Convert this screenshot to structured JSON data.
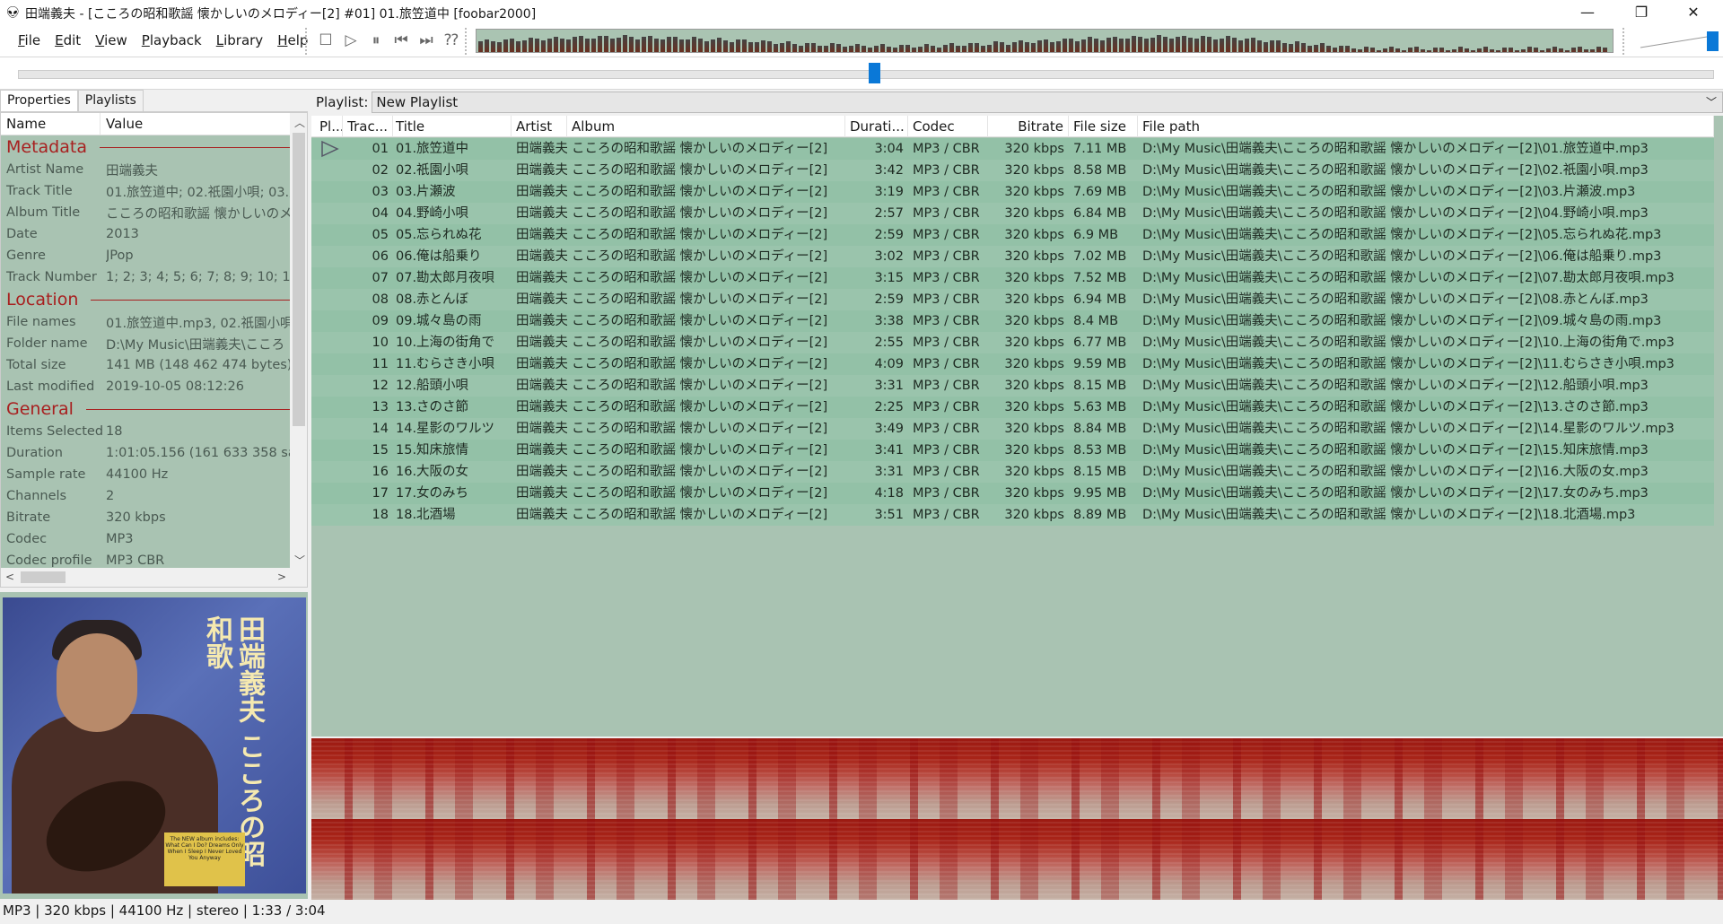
{
  "window": {
    "title": "田端義夫 - [こころの昭和歌謡 懐かしいのメロディー[2] #01] 01.旅笠道中  [foobar2000]",
    "minimize": "—",
    "restore": "❐",
    "close": "✕"
  },
  "menu": [
    "File",
    "Edit",
    "View",
    "Playback",
    "Library",
    "Help"
  ],
  "transport": [
    {
      "name": "stop",
      "glyph": "☐"
    },
    {
      "name": "play",
      "glyph": "▷"
    },
    {
      "name": "pause",
      "glyph": "⏸"
    },
    {
      "name": "previous",
      "glyph": "⏮"
    },
    {
      "name": "next",
      "glyph": "⏭"
    },
    {
      "name": "random",
      "glyph": "⁇"
    }
  ],
  "colors": {
    "accent": "#0a78d7",
    "row": "#93c1a7",
    "panel_bg": "#a9c3b2",
    "section": "#a82020",
    "spectrogram": "#9c1a12"
  },
  "seek": {
    "position": "1:33",
    "length": "3:04",
    "fraction": 0.505
  },
  "volume": {
    "fraction": 0.95
  },
  "left_tabs": [
    "Properties",
    "Playlists"
  ],
  "properties": {
    "headers": {
      "name": "Name",
      "value": "Value"
    },
    "sections": [
      {
        "title": "Metadata",
        "rows": [
          [
            "Artist Name",
            "田端義夫"
          ],
          [
            "Track Title",
            "01.旅笠道中; 02.祇園小唄; 03.片"
          ],
          [
            "Album Title",
            "こころの昭和歌謡 懐かしいのメ"
          ],
          [
            "Date",
            "2013"
          ],
          [
            "Genre",
            "JPop"
          ],
          [
            "Track Number",
            "1; 2; 3; 4; 5; 6; 7; 8; 9; 10; 11; 1"
          ]
        ]
      },
      {
        "title": "Location",
        "rows": [
          [
            "File names",
            "01.旅笠道中.mp3, 02.祇園小唄"
          ],
          [
            "Folder name",
            "D:\\My Music\\田端義夫\\こころ"
          ],
          [
            "Total size",
            "141 MB (148 462 474 bytes)"
          ],
          [
            "Last modified",
            "2019-10-05 08:12:26"
          ]
        ]
      },
      {
        "title": "General",
        "rows": [
          [
            "Items Selected",
            "18"
          ],
          [
            "Duration",
            "1:01:05.156 (161 633 358 sam"
          ],
          [
            "Sample rate",
            "44100 Hz"
          ],
          [
            "Channels",
            "2"
          ],
          [
            "Bitrate",
            "320 kbps"
          ],
          [
            "Codec",
            "MP3"
          ],
          [
            "Codec profile",
            "MP3 CBR"
          ]
        ]
      }
    ]
  },
  "album_art": {
    "text": "田端義夫 こころの昭和歌",
    "sticker": "The NEW album includes: What Can I Do? Dreams Only When I Sleep I Never Loved You Anyway"
  },
  "playlist_bar": {
    "label": "Playlist:",
    "selected": "New Playlist"
  },
  "columns": [
    "Pl...",
    "Trac...",
    "Title",
    "Artist",
    "Album",
    "Durati...",
    "Codec",
    "Bitrate",
    "File size",
    "File path"
  ],
  "tracks": [
    [
      "01",
      "01.旅笠道中",
      "3:04",
      "7.11 MB"
    ],
    [
      "02",
      "02.祇園小唄",
      "3:42",
      "8.58 MB"
    ],
    [
      "03",
      "03.片瀬波",
      "3:19",
      "7.69 MB"
    ],
    [
      "04",
      "04.野崎小唄",
      "2:57",
      "6.84 MB"
    ],
    [
      "05",
      "05.忘られぬ花",
      "2:59",
      "6.9 MB"
    ],
    [
      "06",
      "06.俺は船乗り",
      "3:02",
      "7.02 MB"
    ],
    [
      "07",
      "07.勘太郎月夜唄",
      "3:15",
      "7.52 MB"
    ],
    [
      "08",
      "08.赤とんぼ",
      "2:59",
      "6.94 MB"
    ],
    [
      "09",
      "09.城々島の雨",
      "3:38",
      "8.4 MB"
    ],
    [
      "10",
      "10.上海の街角で",
      "2:55",
      "6.77 MB"
    ],
    [
      "11",
      "11.むらさき小唄",
      "4:09",
      "9.59 MB"
    ],
    [
      "12",
      "12.船頭小唄",
      "3:31",
      "8.15 MB"
    ],
    [
      "13",
      "13.さのさ節",
      "2:25",
      "5.63 MB"
    ],
    [
      "14",
      "14.星影のワルツ",
      "3:49",
      "8.84 MB"
    ],
    [
      "15",
      "15.知床旅情",
      "3:41",
      "8.53 MB"
    ],
    [
      "16",
      "16.大阪の女",
      "3:31",
      "8.15 MB"
    ],
    [
      "17",
      "17.女のみち",
      "4:18",
      "9.95 MB"
    ],
    [
      "18",
      "18.北酒場",
      "3:51",
      "8.89 MB"
    ]
  ],
  "track_common": {
    "artist": "田端義夫",
    "album": "こころの昭和歌謡 懐かしいのメロディー[2]",
    "codec": "MP3 / CBR",
    "bitrate": "320 kbps",
    "path_prefix": "D:\\My Music\\田端義夫\\こころの昭和歌謡 懐かしいのメロディー[2]\\",
    "ext": ".mp3"
  },
  "now_playing_index": 0,
  "status": "MP3 | 320 kbps | 44100 Hz | stereo | 1:33 / 3:04"
}
